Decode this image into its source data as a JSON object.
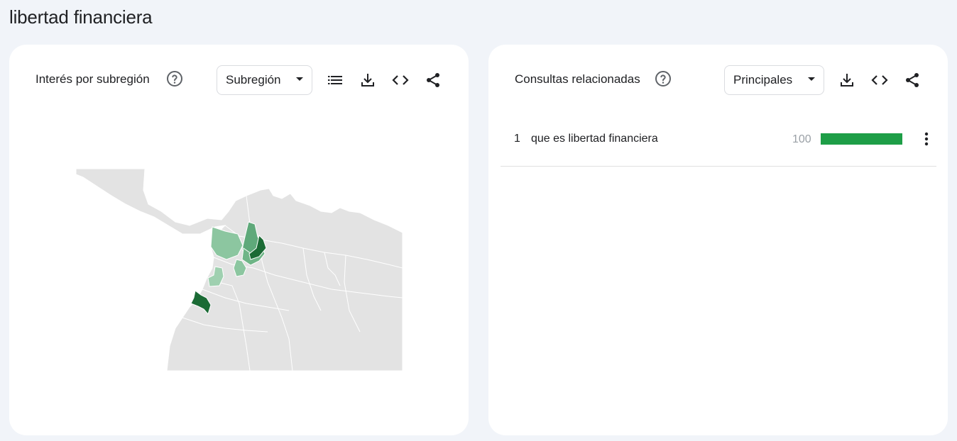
{
  "page": {
    "title": "libertad financiera"
  },
  "left_card": {
    "title": "Interés por subregión",
    "dropdown": {
      "selected": "Subregión"
    },
    "icons": [
      "help-icon",
      "list-icon",
      "download-icon",
      "embed-icon",
      "share-icon"
    ]
  },
  "right_card": {
    "title": "Consultas relacionadas",
    "dropdown": {
      "selected": "Principales"
    },
    "icons": [
      "help-icon",
      "download-icon",
      "embed-icon",
      "share-icon"
    ],
    "rows": [
      {
        "rank": "1",
        "query": "que es libertad financiera",
        "score": "100",
        "fraction": 1.0
      }
    ]
  },
  "colors": {
    "map_base": "#e3e3e3",
    "green_dark": "#1b6b35",
    "green_mid": "#5fa97a",
    "green_light": "#8cc6a0",
    "bar": "#1e9e47"
  }
}
